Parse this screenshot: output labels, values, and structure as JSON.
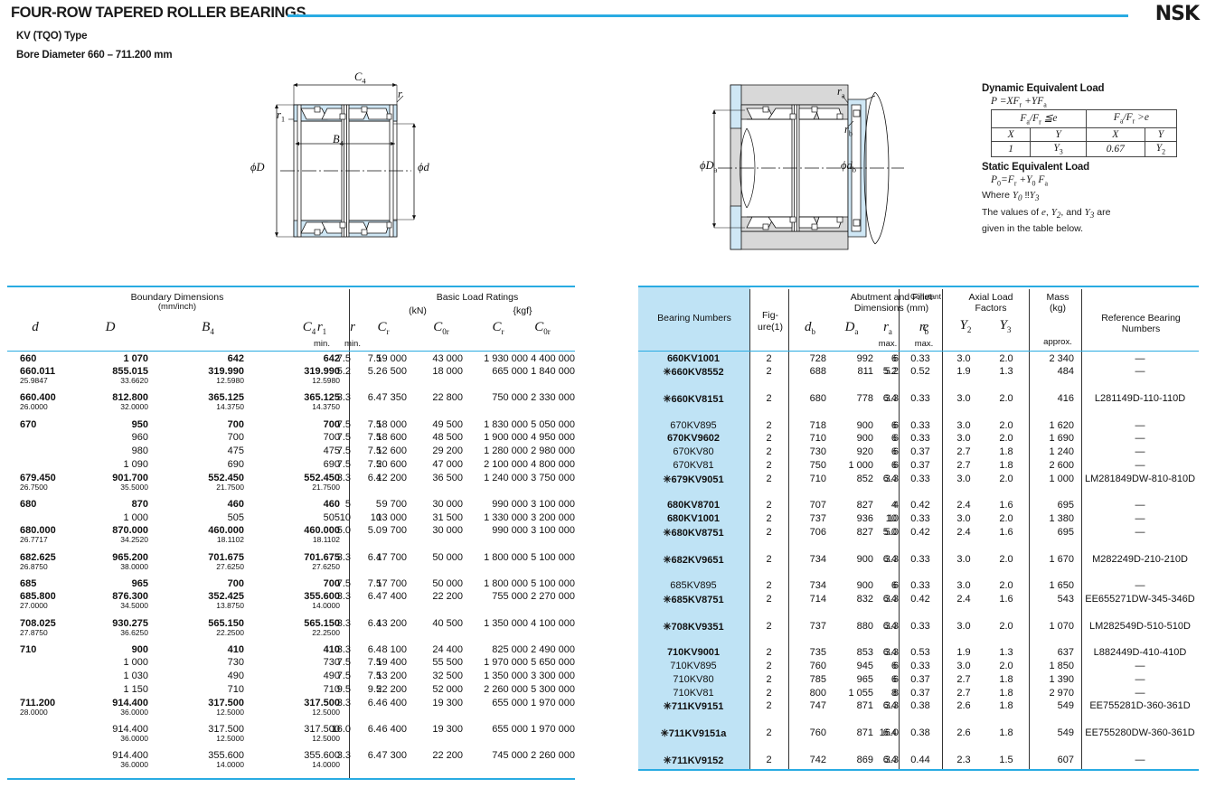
{
  "header": {
    "title": "FOUR-ROW TAPERED ROLLER BEARINGS",
    "subtitle_type": "KV (TQO) Type",
    "subtitle_bore": "Bore Diameter   660 – 711.200 mm",
    "logo": "NSK"
  },
  "diagram_left": {
    "name": "bearing-cross-section",
    "labels": [
      "C4",
      "r",
      "r1",
      "φD",
      "B4",
      "φd"
    ]
  },
  "diagram_right": {
    "name": "bearing-mounting-section",
    "labels": [
      "ra",
      "rb",
      "φDa",
      "φdb"
    ]
  },
  "formula": {
    "dynamic_heading": "Dynamic Equivalent Load",
    "dynamic_eq": "P =XFr +YFa",
    "cond_left": "Fa /Fr ≦e",
    "cond_right": "Fa /Fr >e",
    "col_x1": "X",
    "col_y1": "Y",
    "col_x2": "X",
    "col_y2": "Y",
    "val_x1": "1",
    "val_y1": "Y3",
    "val_x2": "0.67",
    "val_y2": "Y2",
    "static_heading": "Static Equivalent Load",
    "static_eq": "P0=Fr +Y0 Fa",
    "where": "Where Y0 ≒Y3",
    "note1": "The values of e, Y2, and Y3 are",
    "note2": "given in the table below."
  },
  "left_table": {
    "group_boundary": "Boundary Dimensions",
    "group_boundary_unit": "(mm/inch)",
    "group_load": "Basic Load Ratings",
    "unit_kn": "(kN)",
    "unit_kgf": "{kgf}",
    "headers": {
      "d": "d",
      "D": "D",
      "B4": "B4",
      "C4": "C4",
      "r1": "r1",
      "r": "r",
      "min1": "min.",
      "min2": "min.",
      "Cr_kn": "Cr",
      "C0r_kn": "C0r",
      "Cr_kgf": "Cr",
      "C0r_kgf": "C0r"
    },
    "rows": [
      {
        "d": "660",
        "d_in": "",
        "D": "1 070",
        "D_in": "",
        "B4": "642",
        "B4_in": "",
        "C4": "642",
        "C4_in": "",
        "r1": "7.5",
        "r": "7.5",
        "cr": "19 000",
        "c0r": "43 000",
        "crk": "1 930 000",
        "c0rk": "4 400 000",
        "bold": true,
        "gap": 0
      },
      {
        "d": "660.011",
        "d_in": "25.9847",
        "D": "855.015",
        "D_in": "33.6620",
        "B4": "319.990",
        "B4_in": "12.5980",
        "C4": "319.990",
        "C4_in": "12.5980",
        "r1": "5.2",
        "r": "5.2",
        "cr": "6 500",
        "c0r": "18 000",
        "crk": "665 000",
        "c0rk": "1 840 000",
        "bold": true,
        "gap": 0
      },
      {
        "d": "660.400",
        "d_in": "26.0000",
        "D": "812.800",
        "D_in": "32.0000",
        "B4": "365.125",
        "B4_in": "14.3750",
        "C4": "365.125",
        "C4_in": "14.3750",
        "r1": "3.3",
        "r": "6.4",
        "cr": "7 350",
        "c0r": "22 800",
        "crk": "750 000",
        "c0rk": "2 330 000",
        "bold": true,
        "gap": 0
      },
      {
        "d": "670",
        "d_in": "",
        "D": "950",
        "D_in": "",
        "B4": "700",
        "B4_in": "",
        "C4": "700",
        "C4_in": "",
        "r1": "7.5",
        "r": "7.5",
        "cr": "18 000",
        "c0r": "49 500",
        "crk": "1 830 000",
        "c0rk": "5 050 000",
        "bold": true,
        "gap": 0
      },
      {
        "d": "",
        "d_in": "",
        "D": "960",
        "D_in": "",
        "B4": "700",
        "B4_in": "",
        "C4": "700",
        "C4_in": "",
        "r1": "7.5",
        "r": "7.5",
        "cr": "18 600",
        "c0r": "48 500",
        "crk": "1 900 000",
        "c0rk": "4 950 000",
        "bold": false,
        "gap": 0
      },
      {
        "d": "",
        "d_in": "",
        "D": "980",
        "D_in": "",
        "B4": "475",
        "B4_in": "",
        "C4": "475",
        "C4_in": "",
        "r1": "7.5",
        "r": "7.5",
        "cr": "12 600",
        "c0r": "29 200",
        "crk": "1 280 000",
        "c0rk": "2 980 000",
        "bold": false,
        "gap": 0
      },
      {
        "d": "",
        "d_in": "",
        "D": "1 090",
        "D_in": "",
        "B4": "690",
        "B4_in": "",
        "C4": "690",
        "C4_in": "",
        "r1": "7.5",
        "r": "7.5",
        "cr": "20 600",
        "c0r": "47 000",
        "crk": "2 100 000",
        "c0rk": "4 800 000",
        "bold": false,
        "gap": 0
      },
      {
        "d": "679.450",
        "d_in": "26.7500",
        "D": "901.700",
        "D_in": "35.5000",
        "B4": "552.450",
        "B4_in": "21.7500",
        "C4": "552.450",
        "C4_in": "21.7500",
        "r1": "3.3",
        "r": "6.4",
        "cr": "12 200",
        "c0r": "36 500",
        "crk": "1 240 000",
        "c0rk": "3 750 000",
        "bold": true,
        "gap": 0
      },
      {
        "d": "680",
        "d_in": "",
        "D": "870",
        "D_in": "",
        "B4": "460",
        "B4_in": "",
        "C4": "460",
        "C4_in": "",
        "r1": "5",
        "r": "5",
        "cr": "9 700",
        "c0r": "30 000",
        "crk": "990 000",
        "c0rk": "3 100 000",
        "bold": true,
        "gap": 0
      },
      {
        "d": "",
        "d_in": "",
        "D": "1 000",
        "D_in": "",
        "B4": "505",
        "B4_in": "",
        "C4": "505",
        "C4_in": "",
        "r1": "10",
        "r": "10",
        "cr": "13 000",
        "c0r": "31 500",
        "crk": "1 330 000",
        "c0rk": "3 200 000",
        "bold": false,
        "gap": 0
      },
      {
        "d": "680.000",
        "d_in": "26.7717",
        "D": "870.000",
        "D_in": "34.2520",
        "B4": "460.000",
        "B4_in": "18.1102",
        "C4": "460.000",
        "C4_in": "18.1102",
        "r1": "5.0",
        "r": "5.0",
        "cr": "9 700",
        "c0r": "30 000",
        "crk": "990 000",
        "c0rk": "3 100 000",
        "bold": true,
        "gap": 0
      },
      {
        "d": "682.625",
        "d_in": "26.8750",
        "D": "965.200",
        "D_in": "38.0000",
        "B4": "701.675",
        "B4_in": "27.6250",
        "C4": "701.675",
        "C4_in": "27.6250",
        "r1": "3.3",
        "r": "6.4",
        "cr": "17 700",
        "c0r": "50 000",
        "crk": "1 800 000",
        "c0rk": "5 100 000",
        "bold": true,
        "gap": 0
      },
      {
        "d": "685",
        "d_in": "",
        "D": "965",
        "D_in": "",
        "B4": "700",
        "B4_in": "",
        "C4": "700",
        "C4_in": "",
        "r1": "7.5",
        "r": "7.5",
        "cr": "17 700",
        "c0r": "50 000",
        "crk": "1 800 000",
        "c0rk": "5 100 000",
        "bold": true,
        "gap": 0
      },
      {
        "d": "685.800",
        "d_in": "27.0000",
        "D": "876.300",
        "D_in": "34.5000",
        "B4": "352.425",
        "B4_in": "13.8750",
        "C4": "355.600",
        "C4_in": "14.0000",
        "r1": "3.3",
        "r": "6.4",
        "cr": "7 400",
        "c0r": "22 200",
        "crk": "755 000",
        "c0rk": "2 270 000",
        "bold": true,
        "gap": 0
      },
      {
        "d": "708.025",
        "d_in": "27.8750",
        "D": "930.275",
        "D_in": "36.6250",
        "B4": "565.150",
        "B4_in": "22.2500",
        "C4": "565.150",
        "C4_in": "22.2500",
        "r1": "3.3",
        "r": "6.4",
        "cr": "13 200",
        "c0r": "40 500",
        "crk": "1 350 000",
        "c0rk": "4 100 000",
        "bold": true,
        "gap": 0
      },
      {
        "d": "710",
        "d_in": "",
        "D": "900",
        "D_in": "",
        "B4": "410",
        "B4_in": "",
        "C4": "410",
        "C4_in": "",
        "r1": "3.3",
        "r": "6.4",
        "cr": "8 100",
        "c0r": "24 400",
        "crk": "825 000",
        "c0rk": "2 490 000",
        "bold": true,
        "gap": 0
      },
      {
        "d": "",
        "d_in": "",
        "D": "1 000",
        "D_in": "",
        "B4": "730",
        "B4_in": "",
        "C4": "730",
        "C4_in": "",
        "r1": "7.5",
        "r": "7.5",
        "cr": "19 400",
        "c0r": "55 500",
        "crk": "1 970 000",
        "c0rk": "5 650 000",
        "bold": false,
        "gap": 0
      },
      {
        "d": "",
        "d_in": "",
        "D": "1 030",
        "D_in": "",
        "B4": "490",
        "B4_in": "",
        "C4": "490",
        "C4_in": "",
        "r1": "7.5",
        "r": "7.5",
        "cr": "13 200",
        "c0r": "32 500",
        "crk": "1 350 000",
        "c0rk": "3 300 000",
        "bold": false,
        "gap": 0
      },
      {
        "d": "",
        "d_in": "",
        "D": "1 150",
        "D_in": "",
        "B4": "710",
        "B4_in": "",
        "C4": "710",
        "C4_in": "",
        "r1": "9.5",
        "r": "9.5",
        "cr": "22 200",
        "c0r": "52 000",
        "crk": "2 260 000",
        "c0rk": "5 300 000",
        "bold": false,
        "gap": 0
      },
      {
        "d": "711.200",
        "d_in": "28.0000",
        "D": "914.400",
        "D_in": "36.0000",
        "B4": "317.500",
        "B4_in": "12.5000",
        "C4": "317.500",
        "C4_in": "12.5000",
        "r1": "3.3",
        "r": "6.4",
        "cr": "6 400",
        "c0r": "19 300",
        "crk": "655 000",
        "c0rk": "1 970 000",
        "bold": true,
        "gap": 0
      },
      {
        "d": "",
        "d_in": "",
        "D": "914.400",
        "D_in": "36.0000",
        "B4": "317.500",
        "B4_in": "12.5000",
        "C4": "317.500",
        "C4_in": "12.5000",
        "r1": "16.0",
        "r": "6.4",
        "cr": "6 400",
        "c0r": "19 300",
        "crk": "655 000",
        "c0rk": "1 970 000",
        "bold": false,
        "gap": 0
      },
      {
        "d": "",
        "d_in": "",
        "D": "914.400",
        "D_in": "36.0000",
        "B4": "355.600",
        "B4_in": "14.0000",
        "C4": "355.600",
        "C4_in": "14.0000",
        "r1": "3.3",
        "r": "6.4",
        "cr": "7 300",
        "c0r": "22 200",
        "crk": "745 000",
        "c0rk": "2 260 000",
        "bold": false,
        "gap": 0
      }
    ]
  },
  "right_table": {
    "col_bearing": "Bearing Numbers",
    "col_figure": "Fig-\nure(1)",
    "col_figure_a": "Fig-",
    "col_figure_b": "ure(1)",
    "group_abutment_a": "Abutment and Fillet",
    "group_abutment_b": "Dimensions (mm)",
    "col_constant": "Constant",
    "group_axial_a": "Axial Load",
    "group_axial_b": "Factors",
    "col_mass_a": "Mass",
    "col_mass_b": "(kg)",
    "col_mass_c": "approx.",
    "col_reference": "Reference Bearing Numbers",
    "headers": {
      "db": "db",
      "Da": "Da",
      "ra": "ra",
      "rb": "rb",
      "max1": "max.",
      "max2": "max.",
      "e": "e",
      "Y2": "Y2",
      "Y3": "Y3"
    },
    "rows": [
      {
        "bn": "660KV1001",
        "star": false,
        "bold": true,
        "fig": "2",
        "db": "728",
        "Da": "992",
        "ra": "6",
        "rb": "6",
        "e": "0.33",
        "y2": "3.0",
        "y3": "2.0",
        "mass": "2 340",
        "ref": "—"
      },
      {
        "bn": "660KV8552",
        "star": true,
        "bold": true,
        "fig": "2",
        "db": "688",
        "Da": "811",
        "ra": "5.2",
        "rb": "5.2",
        "e": "0.52",
        "y2": "1.9",
        "y3": "1.3",
        "mass": "484",
        "ref": "—"
      },
      {
        "bn": "",
        "star": false,
        "bold": false,
        "fig": "",
        "db": "",
        "Da": "",
        "ra": "",
        "rb": "",
        "e": "",
        "y2": "",
        "y3": "",
        "mass": "",
        "ref": ""
      },
      {
        "bn": "660KV8151",
        "star": true,
        "bold": true,
        "fig": "2",
        "db": "680",
        "Da": "778",
        "ra": "6.4",
        "rb": "3.3",
        "e": "0.33",
        "y2": "3.0",
        "y3": "2.0",
        "mass": "416",
        "ref": "L281149D-110-110D"
      },
      {
        "bn": "",
        "star": false,
        "bold": false,
        "fig": "",
        "db": "",
        "Da": "",
        "ra": "",
        "rb": "",
        "e": "",
        "y2": "",
        "y3": "",
        "mass": "",
        "ref": ""
      },
      {
        "bn": "670KV895",
        "star": false,
        "bold": false,
        "fig": "2",
        "db": "718",
        "Da": "900",
        "ra": "6",
        "rb": "6",
        "e": "0.33",
        "y2": "3.0",
        "y3": "2.0",
        "mass": "1 620",
        "ref": "—"
      },
      {
        "bn": "670KV9602",
        "star": false,
        "bold": true,
        "fig": "2",
        "db": "710",
        "Da": "900",
        "ra": "6",
        "rb": "6",
        "e": "0.33",
        "y2": "3.0",
        "y3": "2.0",
        "mass": "1 690",
        "ref": "—"
      },
      {
        "bn": "670KV80",
        "star": false,
        "bold": false,
        "fig": "2",
        "db": "730",
        "Da": "920",
        "ra": "6",
        "rb": "6",
        "e": "0.37",
        "y2": "2.7",
        "y3": "1.8",
        "mass": "1 240",
        "ref": "—"
      },
      {
        "bn": "670KV81",
        "star": false,
        "bold": false,
        "fig": "2",
        "db": "750",
        "Da": "1 000",
        "ra": "6",
        "rb": "6",
        "e": "0.37",
        "y2": "2.7",
        "y3": "1.8",
        "mass": "2 600",
        "ref": "—"
      },
      {
        "bn": "679KV9051",
        "star": true,
        "bold": true,
        "fig": "2",
        "db": "710",
        "Da": "852",
        "ra": "6.4",
        "rb": "3.3",
        "e": "0.33",
        "y2": "3.0",
        "y3": "2.0",
        "mass": "1 000",
        "ref": "LM281849DW-810-810D"
      },
      {
        "bn": "",
        "star": false,
        "bold": false,
        "fig": "",
        "db": "",
        "Da": "",
        "ra": "",
        "rb": "",
        "e": "",
        "y2": "",
        "y3": "",
        "mass": "",
        "ref": ""
      },
      {
        "bn": "680KV8701",
        "star": false,
        "bold": true,
        "fig": "2",
        "db": "707",
        "Da": "827",
        "ra": "4",
        "rb": "4",
        "e": "0.42",
        "y2": "2.4",
        "y3": "1.6",
        "mass": "695",
        "ref": "—"
      },
      {
        "bn": "680KV1001",
        "star": false,
        "bold": true,
        "fig": "2",
        "db": "737",
        "Da": "936",
        "ra": "10",
        "rb": "10",
        "e": "0.33",
        "y2": "3.0",
        "y3": "2.0",
        "mass": "1 380",
        "ref": "—"
      },
      {
        "bn": "680KV8751",
        "star": true,
        "bold": true,
        "fig": "2",
        "db": "706",
        "Da": "827",
        "ra": "5.0",
        "rb": "5.0",
        "e": "0.42",
        "y2": "2.4",
        "y3": "1.6",
        "mass": "695",
        "ref": "—"
      },
      {
        "bn": "",
        "star": false,
        "bold": false,
        "fig": "",
        "db": "",
        "Da": "",
        "ra": "",
        "rb": "",
        "e": "",
        "y2": "",
        "y3": "",
        "mass": "",
        "ref": ""
      },
      {
        "bn": "682KV9651",
        "star": true,
        "bold": true,
        "fig": "2",
        "db": "734",
        "Da": "900",
        "ra": "6.4",
        "rb": "3.3",
        "e": "0.33",
        "y2": "3.0",
        "y3": "2.0",
        "mass": "1 670",
        "ref": "M282249D-210-210D"
      },
      {
        "bn": "",
        "star": false,
        "bold": false,
        "fig": "",
        "db": "",
        "Da": "",
        "ra": "",
        "rb": "",
        "e": "",
        "y2": "",
        "y3": "",
        "mass": "",
        "ref": ""
      },
      {
        "bn": "685KV895",
        "star": false,
        "bold": false,
        "fig": "2",
        "db": "734",
        "Da": "900",
        "ra": "6",
        "rb": "6",
        "e": "0.33",
        "y2": "3.0",
        "y3": "2.0",
        "mass": "1 650",
        "ref": "—"
      },
      {
        "bn": "685KV8751",
        "star": true,
        "bold": true,
        "fig": "2",
        "db": "714",
        "Da": "832",
        "ra": "6.4",
        "rb": "3.3",
        "e": "0.42",
        "y2": "2.4",
        "y3": "1.6",
        "mass": "543",
        "ref": "EE655271DW-345-346D"
      },
      {
        "bn": "",
        "star": false,
        "bold": false,
        "fig": "",
        "db": "",
        "Da": "",
        "ra": "",
        "rb": "",
        "e": "",
        "y2": "",
        "y3": "",
        "mass": "",
        "ref": ""
      },
      {
        "bn": "708KV9351",
        "star": true,
        "bold": true,
        "fig": "2",
        "db": "737",
        "Da": "880",
        "ra": "6.4",
        "rb": "3.3",
        "e": "0.33",
        "y2": "3.0",
        "y3": "2.0",
        "mass": "1 070",
        "ref": "LM282549D-510-510D"
      },
      {
        "bn": "",
        "star": false,
        "bold": false,
        "fig": "",
        "db": "",
        "Da": "",
        "ra": "",
        "rb": "",
        "e": "",
        "y2": "",
        "y3": "",
        "mass": "",
        "ref": ""
      },
      {
        "bn": "710KV9001",
        "star": false,
        "bold": true,
        "fig": "2",
        "db": "735",
        "Da": "853",
        "ra": "6.4",
        "rb": "3.3",
        "e": "0.53",
        "y2": "1.9",
        "y3": "1.3",
        "mass": "637",
        "ref": "L882449D-410-410D"
      },
      {
        "bn": "710KV895",
        "star": false,
        "bold": false,
        "fig": "2",
        "db": "760",
        "Da": "945",
        "ra": "6",
        "rb": "6",
        "e": "0.33",
        "y2": "3.0",
        "y3": "2.0",
        "mass": "1 850",
        "ref": "—"
      },
      {
        "bn": "710KV80",
        "star": false,
        "bold": false,
        "fig": "2",
        "db": "785",
        "Da": "965",
        "ra": "6",
        "rb": "6",
        "e": "0.37",
        "y2": "2.7",
        "y3": "1.8",
        "mass": "1 390",
        "ref": "—"
      },
      {
        "bn": "710KV81",
        "star": false,
        "bold": false,
        "fig": "2",
        "db": "800",
        "Da": "1 055",
        "ra": "8",
        "rb": "8",
        "e": "0.37",
        "y2": "2.7",
        "y3": "1.8",
        "mass": "2 970",
        "ref": "—"
      },
      {
        "bn": "711KV9151",
        "star": true,
        "bold": true,
        "fig": "2",
        "db": "747",
        "Da": "871",
        "ra": "6.4",
        "rb": "3.3",
        "e": "0.38",
        "y2": "2.6",
        "y3": "1.8",
        "mass": "549",
        "ref": "EE755281D-360-361D"
      },
      {
        "bn": "",
        "star": false,
        "bold": false,
        "fig": "",
        "db": "",
        "Da": "",
        "ra": "",
        "rb": "",
        "e": "",
        "y2": "",
        "y3": "",
        "mass": "",
        "ref": ""
      },
      {
        "bn": "711KV9151a",
        "star": true,
        "bold": true,
        "fig": "2",
        "db": "760",
        "Da": "871",
        "ra": "6.4",
        "rb": "16.0",
        "e": "0.38",
        "y2": "2.6",
        "y3": "1.8",
        "mass": "549",
        "ref": "EE755280DW-360-361D"
      },
      {
        "bn": "",
        "star": false,
        "bold": false,
        "fig": "",
        "db": "",
        "Da": "",
        "ra": "",
        "rb": "",
        "e": "",
        "y2": "",
        "y3": "",
        "mass": "",
        "ref": ""
      },
      {
        "bn": "711KV9152",
        "star": true,
        "bold": true,
        "fig": "2",
        "db": "742",
        "Da": "869",
        "ra": "6.4",
        "rb": "3.3",
        "e": "0.44",
        "y2": "2.3",
        "y3": "1.5",
        "mass": "607",
        "ref": "—"
      }
    ]
  },
  "colors": {
    "accent_cyan": "#29abe2",
    "highlight_blue": "#bfe3f5",
    "diagram_fill": "#cfe7f5",
    "diagram_gray": "#d8d8d8",
    "text": "#111111"
  }
}
